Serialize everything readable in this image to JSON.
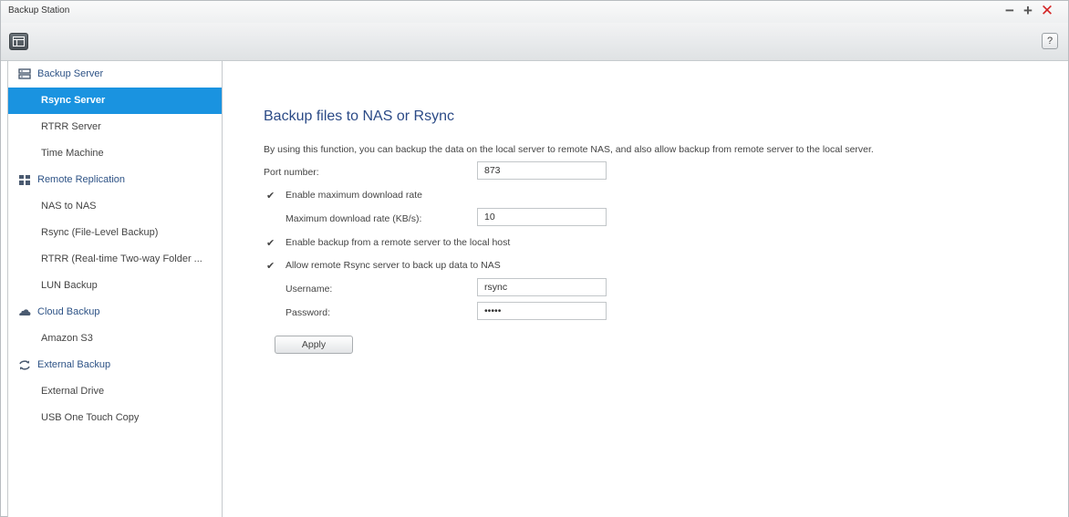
{
  "window": {
    "title": "Backup Station",
    "minimize_glyph": "−",
    "maximize_glyph": "+",
    "close_glyph": "✕"
  },
  "toolbar": {
    "menu_icon": "grid-menu-icon",
    "help_label": "?"
  },
  "sidebar": {
    "groups": [
      {
        "label": "Backup Server",
        "icon": "server-icon",
        "items": [
          "Rsync Server",
          "RTRR Server",
          "Time Machine"
        ]
      },
      {
        "label": "Remote Replication",
        "icon": "replication-icon",
        "items": [
          "NAS to NAS",
          "Rsync (File-Level Backup)",
          "RTRR (Real-time Two-way Folder ...",
          "LUN Backup"
        ]
      },
      {
        "label": "Cloud Backup",
        "icon": "cloud-icon",
        "items": [
          "Amazon S3"
        ]
      },
      {
        "label": "External Backup",
        "icon": "sync-arrows-icon",
        "items": [
          "External Drive",
          "USB One Touch Copy"
        ]
      }
    ],
    "active_item": "Rsync Server"
  },
  "main": {
    "title": "Backup files to NAS or Rsync",
    "description": "By using this function, you can backup the data on the local server to remote NAS, and also allow backup from remote server to the local server.",
    "port_label": "Port number:",
    "port_value": "873",
    "enable_max_rate_label": "Enable maximum download rate",
    "enable_max_rate_checked": true,
    "max_rate_label": "Maximum download rate (KB/s):",
    "max_rate_value": "10",
    "enable_remote_backup_label": "Enable backup from a remote server to the local host",
    "enable_remote_backup_checked": true,
    "allow_rsync_label": "Allow remote Rsync server to back up data to NAS",
    "allow_rsync_checked": true,
    "username_label": "Username:",
    "username_value": "rsync",
    "password_label": "Password:",
    "password_value": "•••••",
    "apply_label": "Apply"
  },
  "colors": {
    "accent": "#1a93e0",
    "group_text": "#2e5386",
    "title_text": "#2b4a86",
    "close": "#d42626"
  }
}
